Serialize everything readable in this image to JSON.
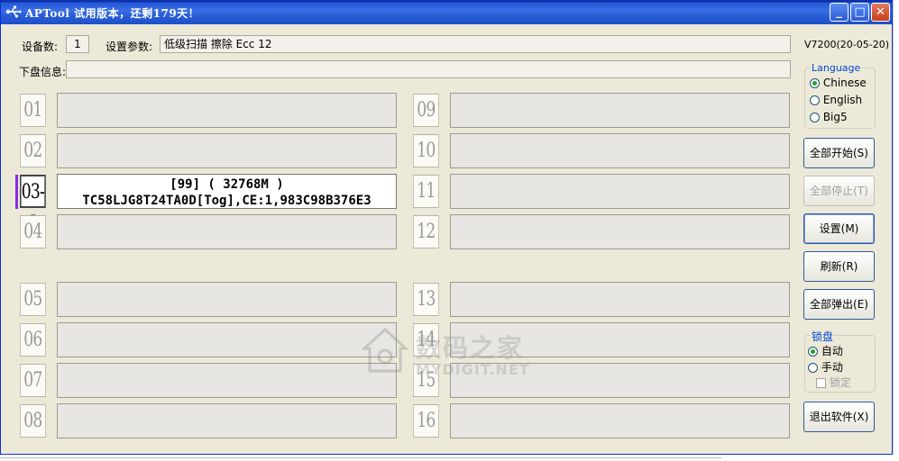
{
  "window": {
    "title": "APTool  试用版本，还剩179天！",
    "btn_minimize": "_",
    "btn_maximize": "□",
    "btn_close": "✕"
  },
  "header": {
    "device_count_label": "设备数:",
    "device_count": "1",
    "settings_label": "设置参数:",
    "settings_value": "低级扫描 擦除 Ecc 12",
    "version": "V7200(20-05-20)",
    "disk_info_label": "下盘信息:",
    "disk_info_value": ""
  },
  "slots": {
    "s01": "01",
    "s02": "02",
    "s03": "03-I",
    "s04": "04",
    "s05": "05",
    "s06": "06",
    "s07": "07",
    "s08": "08",
    "s09": "09",
    "s10": "10",
    "s11": "11",
    "s12": "12",
    "s13": "13",
    "s14": "14",
    "s15": "15",
    "s16": "16"
  },
  "active_slot": {
    "line1": "[99] ( 32768M )",
    "line2": "TC58LJG8T24TA0D[Tog],CE:1,983C98B376E3"
  },
  "language": {
    "title": "Language",
    "options": [
      "Chinese",
      "English",
      "Big5"
    ],
    "selected": "Chinese"
  },
  "buttons": {
    "start_all": "全部开始(S)",
    "stop_all": "全部停止(T)",
    "settings": "设置(M)",
    "refresh": "刷新(R)",
    "eject_all": "全部弹出(E)",
    "exit": "退出软件(X)"
  },
  "lock": {
    "title": "锁盘",
    "auto": "自动",
    "manual": "手动",
    "lock": "锁定",
    "selected": "自动"
  },
  "watermark": {
    "cn": "数码之家",
    "en": "MYDIGIT.NET"
  },
  "colors": {
    "titlebar": "#2456d8",
    "face": "#ece9d8",
    "active_accent": "#8a2be2",
    "radio_dot": "#21a121"
  }
}
